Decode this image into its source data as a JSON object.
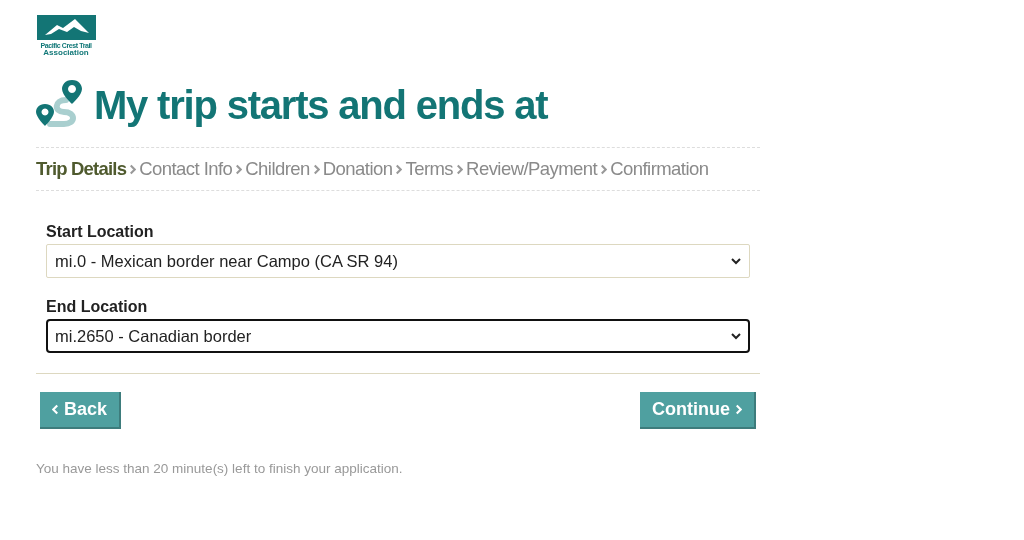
{
  "logo": {
    "line_1": "Pacific Crest Trail",
    "line_2": "Association"
  },
  "heading": "My trip starts and ends at",
  "steps": [
    {
      "label": "Trip Details",
      "selected": true
    },
    {
      "label": "Contact Info",
      "selected": false
    },
    {
      "label": "Children",
      "selected": false
    },
    {
      "label": "Donation",
      "selected": false
    },
    {
      "label": "Terms",
      "selected": false
    },
    {
      "label": "Review/Payment",
      "selected": false
    },
    {
      "label": "Confirmation",
      "selected": false
    }
  ],
  "fields": [
    {
      "label": "Start Location",
      "value": "mi.0 - Mexican border near Campo (CA SR 94)",
      "focused": false
    },
    {
      "label": "End Location",
      "value": "mi.2650 - Canadian border",
      "focused": true
    }
  ],
  "buttons": {
    "back": "Back",
    "continue": "Continue"
  },
  "notice": "You have less than 20 minute(s) left to finish your application."
}
